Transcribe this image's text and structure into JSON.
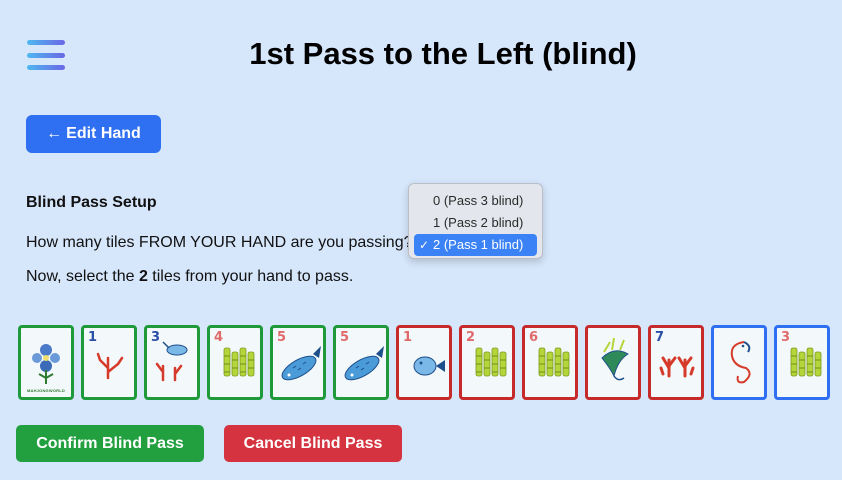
{
  "header": {
    "title": "1st Pass to the Left (blind)",
    "menu_icon": "hamburger-menu-icon"
  },
  "edit_hand": {
    "arrow": "←",
    "label": "Edit Hand"
  },
  "setup": {
    "heading": "Blind Pass Setup",
    "question": "How many tiles FROM YOUR HAND are you passing?",
    "instruction_prefix": "Now, select the ",
    "instruction_count": "2",
    "instruction_suffix": " tiles from your hand to pass."
  },
  "dropdown": {
    "options": [
      "0 (Pass 3 blind)",
      "1 (Pass 2 blind)",
      "2 (Pass 1 blind)"
    ],
    "selected_index": 2,
    "check_mark": "✓"
  },
  "tiles": [
    {
      "suit": "flower",
      "number": "",
      "label": "MAHJONGWORLD",
      "color": "#1f9a3a",
      "border": "green"
    },
    {
      "suit": "coral",
      "number": "1",
      "color": "#2a4da8",
      "border": "green"
    },
    {
      "suit": "coral-bird",
      "number": "3",
      "color": "#2a4da8",
      "border": "green"
    },
    {
      "suit": "bamboo",
      "number": "4",
      "color": "#e06a6a",
      "border": "green"
    },
    {
      "suit": "fish",
      "number": "5",
      "color": "#e06a6a",
      "border": "green"
    },
    {
      "suit": "fish",
      "number": "5",
      "color": "#e06a6a",
      "border": "green"
    },
    {
      "suit": "fish-small",
      "number": "1",
      "color": "#e06a6a",
      "border": "red"
    },
    {
      "suit": "bamboo",
      "number": "2",
      "color": "#e06a6a",
      "border": "red"
    },
    {
      "suit": "bamboo",
      "number": "6",
      "color": "#e06a6a",
      "border": "red"
    },
    {
      "suit": "bird",
      "number": "",
      "color": "#2a4da8",
      "border": "red"
    },
    {
      "suit": "coral-red",
      "number": "7",
      "color": "#2a4da8",
      "border": "red"
    },
    {
      "suit": "seahorse",
      "number": "",
      "color": "#2a4da8",
      "border": "blue"
    },
    {
      "suit": "bamboo",
      "number": "3",
      "color": "#e06a6a",
      "border": "blue"
    }
  ],
  "actions": {
    "confirm_label": "Confirm Blind Pass",
    "cancel_label": "Cancel Blind Pass"
  },
  "colors": {
    "background": "#d6e6fb",
    "primary": "#2f6ff2",
    "confirm": "#22a040",
    "cancel": "#d4333f"
  }
}
